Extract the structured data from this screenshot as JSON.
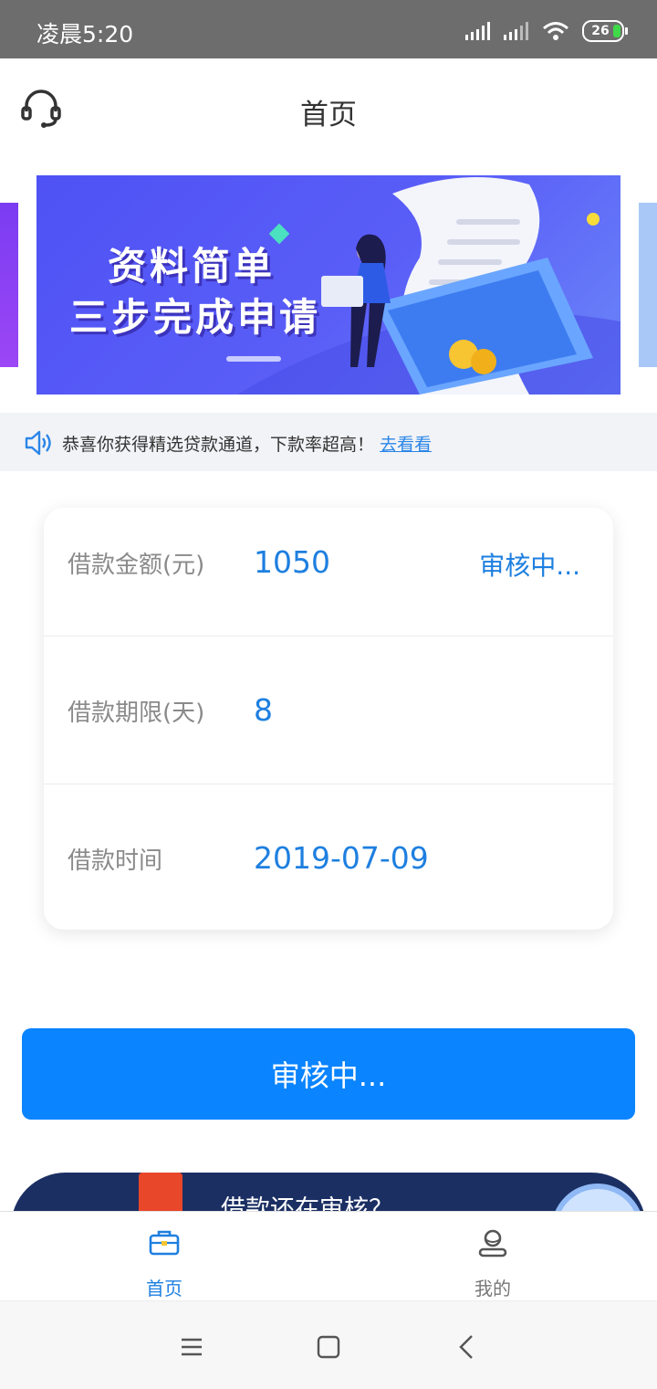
{
  "status_bar": {
    "time": "凌晨5:20",
    "battery": "26"
  },
  "header": {
    "title": "首页"
  },
  "banner": {
    "line1": "资料简单",
    "line2": "三步完成申请"
  },
  "notice": {
    "text": "恭喜你获得精选贷款通道，下款率超高！",
    "link": "去看看"
  },
  "loan": {
    "amount_label": "借款金额(元)",
    "amount_value": "1050",
    "status": "审核中...",
    "term_label": "借款期限(天)",
    "term_value": "8",
    "date_label": "借款时间",
    "date_value": "2019-07-09"
  },
  "main_button": {
    "label": "审核中..."
  },
  "promo": {
    "text": "借款还在审核？"
  },
  "tabs": [
    {
      "label": "首页",
      "icon": "briefcase-icon",
      "active": true
    },
    {
      "label": "我的",
      "icon": "user-icon",
      "active": false
    }
  ],
  "colors": {
    "accent": "#0a84ff",
    "value_text": "#1e7fe0",
    "notice_bg": "#f2f3f7"
  }
}
